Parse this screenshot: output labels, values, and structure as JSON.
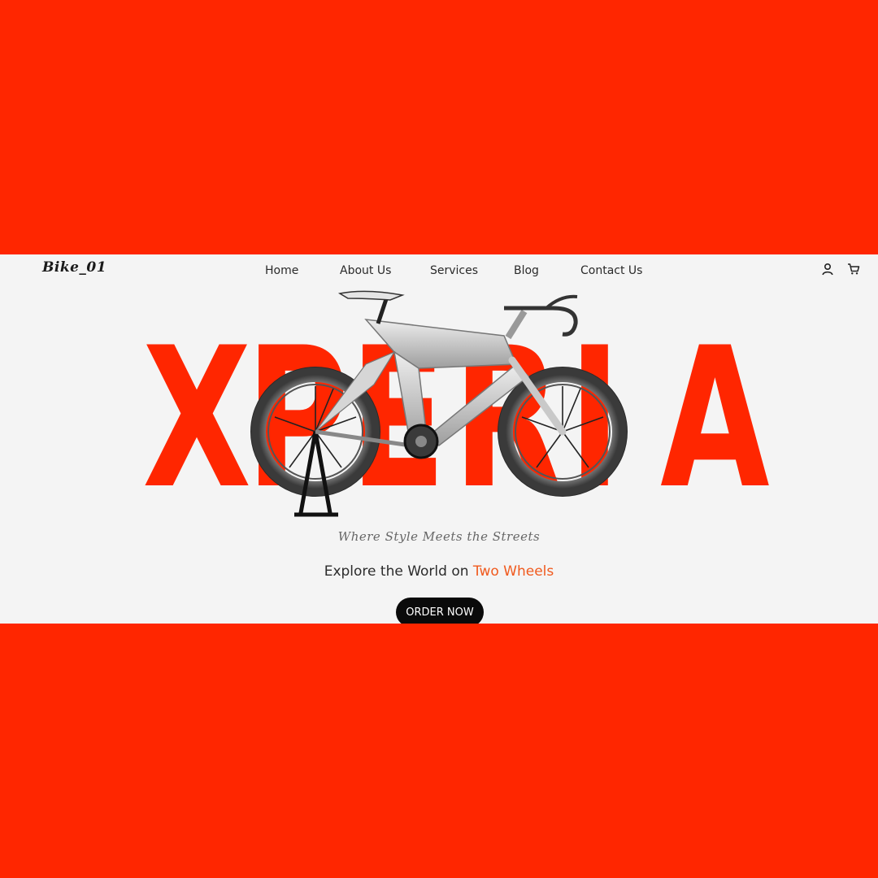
{
  "header": {
    "logo": "Bike_01",
    "nav": [
      {
        "label": "Home"
      },
      {
        "label": "About Us"
      },
      {
        "label": "Services"
      },
      {
        "label": "Blog"
      },
      {
        "label": "Contact Us"
      }
    ],
    "icons": [
      "user-icon",
      "cart-icon"
    ]
  },
  "hero": {
    "letters": [
      "X",
      "P",
      "E",
      "R",
      "I",
      "A"
    ],
    "tagline": "Where Style Meets the Streets",
    "explore_prefix": "Explore the World on ",
    "explore_accent": "Two Wheels",
    "cta_label": "ORDER NOW"
  },
  "colors": {
    "brand_red": "#ff2600",
    "accent_orange": "#f05a1e",
    "button_black": "#0a0a0a",
    "page_bg": "#f4f4f4"
  }
}
